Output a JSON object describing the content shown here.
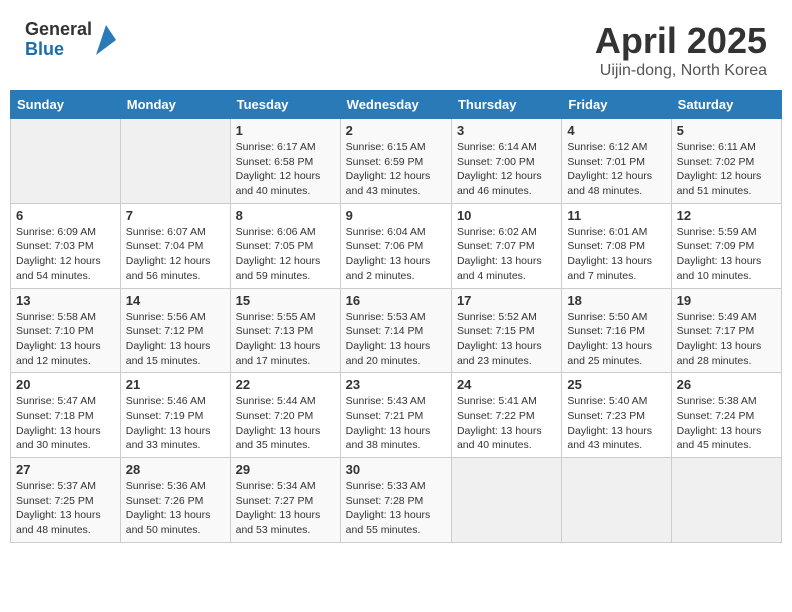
{
  "header": {
    "logo": {
      "general": "General",
      "blue": "Blue"
    },
    "title": "April 2025",
    "location": "Uijin-dong, North Korea"
  },
  "weekdays": [
    "Sunday",
    "Monday",
    "Tuesday",
    "Wednesday",
    "Thursday",
    "Friday",
    "Saturday"
  ],
  "weeks": [
    [
      {
        "day": null,
        "info": null
      },
      {
        "day": null,
        "info": null
      },
      {
        "day": "1",
        "info": "Sunrise: 6:17 AM\nSunset: 6:58 PM\nDaylight: 12 hours and 40 minutes."
      },
      {
        "day": "2",
        "info": "Sunrise: 6:15 AM\nSunset: 6:59 PM\nDaylight: 12 hours and 43 minutes."
      },
      {
        "day": "3",
        "info": "Sunrise: 6:14 AM\nSunset: 7:00 PM\nDaylight: 12 hours and 46 minutes."
      },
      {
        "day": "4",
        "info": "Sunrise: 6:12 AM\nSunset: 7:01 PM\nDaylight: 12 hours and 48 minutes."
      },
      {
        "day": "5",
        "info": "Sunrise: 6:11 AM\nSunset: 7:02 PM\nDaylight: 12 hours and 51 minutes."
      }
    ],
    [
      {
        "day": "6",
        "info": "Sunrise: 6:09 AM\nSunset: 7:03 PM\nDaylight: 12 hours and 54 minutes."
      },
      {
        "day": "7",
        "info": "Sunrise: 6:07 AM\nSunset: 7:04 PM\nDaylight: 12 hours and 56 minutes."
      },
      {
        "day": "8",
        "info": "Sunrise: 6:06 AM\nSunset: 7:05 PM\nDaylight: 12 hours and 59 minutes."
      },
      {
        "day": "9",
        "info": "Sunrise: 6:04 AM\nSunset: 7:06 PM\nDaylight: 13 hours and 2 minutes."
      },
      {
        "day": "10",
        "info": "Sunrise: 6:02 AM\nSunset: 7:07 PM\nDaylight: 13 hours and 4 minutes."
      },
      {
        "day": "11",
        "info": "Sunrise: 6:01 AM\nSunset: 7:08 PM\nDaylight: 13 hours and 7 minutes."
      },
      {
        "day": "12",
        "info": "Sunrise: 5:59 AM\nSunset: 7:09 PM\nDaylight: 13 hours and 10 minutes."
      }
    ],
    [
      {
        "day": "13",
        "info": "Sunrise: 5:58 AM\nSunset: 7:10 PM\nDaylight: 13 hours and 12 minutes."
      },
      {
        "day": "14",
        "info": "Sunrise: 5:56 AM\nSunset: 7:12 PM\nDaylight: 13 hours and 15 minutes."
      },
      {
        "day": "15",
        "info": "Sunrise: 5:55 AM\nSunset: 7:13 PM\nDaylight: 13 hours and 17 minutes."
      },
      {
        "day": "16",
        "info": "Sunrise: 5:53 AM\nSunset: 7:14 PM\nDaylight: 13 hours and 20 minutes."
      },
      {
        "day": "17",
        "info": "Sunrise: 5:52 AM\nSunset: 7:15 PM\nDaylight: 13 hours and 23 minutes."
      },
      {
        "day": "18",
        "info": "Sunrise: 5:50 AM\nSunset: 7:16 PM\nDaylight: 13 hours and 25 minutes."
      },
      {
        "day": "19",
        "info": "Sunrise: 5:49 AM\nSunset: 7:17 PM\nDaylight: 13 hours and 28 minutes."
      }
    ],
    [
      {
        "day": "20",
        "info": "Sunrise: 5:47 AM\nSunset: 7:18 PM\nDaylight: 13 hours and 30 minutes."
      },
      {
        "day": "21",
        "info": "Sunrise: 5:46 AM\nSunset: 7:19 PM\nDaylight: 13 hours and 33 minutes."
      },
      {
        "day": "22",
        "info": "Sunrise: 5:44 AM\nSunset: 7:20 PM\nDaylight: 13 hours and 35 minutes."
      },
      {
        "day": "23",
        "info": "Sunrise: 5:43 AM\nSunset: 7:21 PM\nDaylight: 13 hours and 38 minutes."
      },
      {
        "day": "24",
        "info": "Sunrise: 5:41 AM\nSunset: 7:22 PM\nDaylight: 13 hours and 40 minutes."
      },
      {
        "day": "25",
        "info": "Sunrise: 5:40 AM\nSunset: 7:23 PM\nDaylight: 13 hours and 43 minutes."
      },
      {
        "day": "26",
        "info": "Sunrise: 5:38 AM\nSunset: 7:24 PM\nDaylight: 13 hours and 45 minutes."
      }
    ],
    [
      {
        "day": "27",
        "info": "Sunrise: 5:37 AM\nSunset: 7:25 PM\nDaylight: 13 hours and 48 minutes."
      },
      {
        "day": "28",
        "info": "Sunrise: 5:36 AM\nSunset: 7:26 PM\nDaylight: 13 hours and 50 minutes."
      },
      {
        "day": "29",
        "info": "Sunrise: 5:34 AM\nSunset: 7:27 PM\nDaylight: 13 hours and 53 minutes."
      },
      {
        "day": "30",
        "info": "Sunrise: 5:33 AM\nSunset: 7:28 PM\nDaylight: 13 hours and 55 minutes."
      },
      {
        "day": null,
        "info": null
      },
      {
        "day": null,
        "info": null
      },
      {
        "day": null,
        "info": null
      }
    ]
  ]
}
